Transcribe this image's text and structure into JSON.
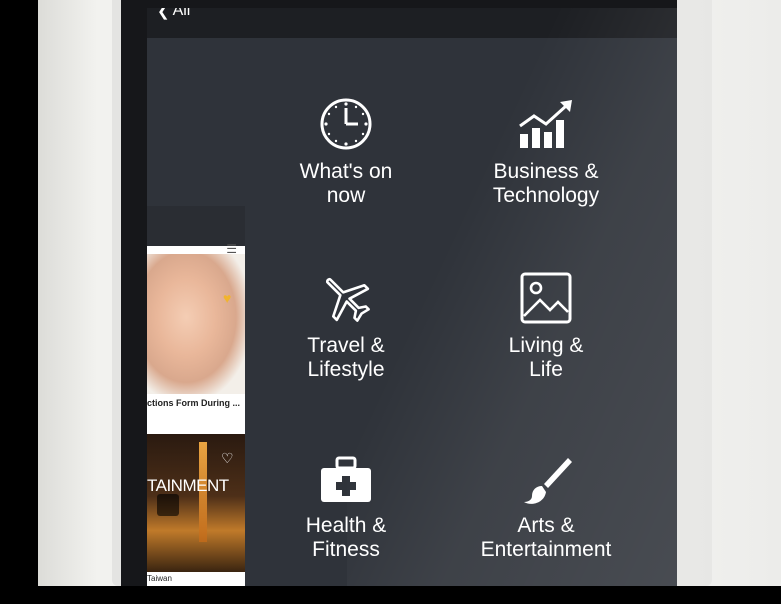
{
  "nav": {
    "back_label": "All"
  },
  "categories": [
    {
      "label": "What's on\nnow",
      "icon": "clock-icon"
    },
    {
      "label": "Business &\nTechnology",
      "icon": "growth-chart-icon"
    },
    {
      "label": "Travel &\nLifestyle",
      "icon": "airplane-icon"
    },
    {
      "label": "Living &\nLife",
      "icon": "image-icon"
    },
    {
      "label": "Health &\nFitness",
      "icon": "first-aid-kit-icon"
    },
    {
      "label": "Arts &\nEntertainment",
      "icon": "paintbrush-icon"
    }
  ],
  "preview_card": {
    "caption1": "ctions Form During ...",
    "overlay_text": "TAINMENT",
    "caption2": "Taiwan"
  },
  "colors": {
    "screen_bg": "#2f333a",
    "topbar_bg": "#1d1f23",
    "accent_yellow": "#f1b42d"
  }
}
